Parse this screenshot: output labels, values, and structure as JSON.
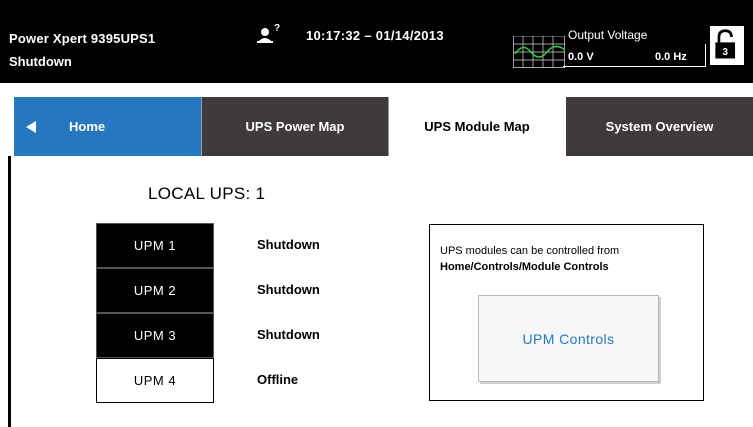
{
  "header": {
    "device_name": "Power Xpert 9395UPS1",
    "device_state": "Shutdown",
    "user_level": "?",
    "datetime": "10:17:32 – 01/14/2013",
    "output_voltage_label": "Output Voltage",
    "output_voltage_value": "0.0 V",
    "output_frequency_value": "0.0 Hz",
    "lock_icon": "lock-icon",
    "lock_level": "3"
  },
  "tabs": [
    {
      "label": "Home",
      "active": false
    },
    {
      "label": "UPS Power Map",
      "active": false
    },
    {
      "label": "UPS Module Map",
      "active": true
    },
    {
      "label": "System Overview",
      "active": false
    }
  ],
  "colors": {
    "header_bg": "#000000",
    "home_tab": "#2478c2",
    "inactive_tab": "#3f3a3c",
    "link_text": "#2478c2"
  },
  "main": {
    "local_ups_label": "LOCAL UPS: 1",
    "modules": [
      {
        "name": "UPM 1",
        "status": "Shutdown"
      },
      {
        "name": "UPM 2",
        "status": "Shutdown"
      },
      {
        "name": "UPM 3",
        "status": "Shutdown"
      },
      {
        "name": "UPM 4",
        "status": "Offline"
      }
    ],
    "controls_panel": {
      "line1": "UPS modules can be controlled from",
      "line2": "Home/Controls/Module Controls",
      "button_label": "UPM Controls"
    }
  }
}
